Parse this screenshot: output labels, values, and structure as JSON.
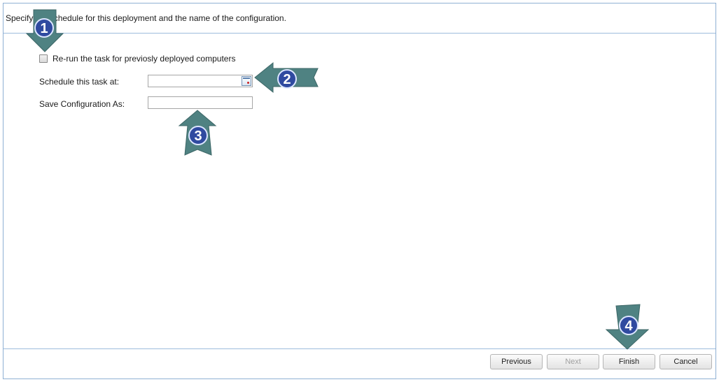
{
  "header": {
    "text": "Specify the schedule for this deployment and the name of the configuration."
  },
  "form": {
    "rerun_label": "Re-run the task for previosly deployed computers",
    "rerun_checked": false,
    "schedule_label": "Schedule this task at:",
    "schedule_value": "",
    "save_label": "Save Configuration As:",
    "save_value": ""
  },
  "footer": {
    "previous": "Previous",
    "next": "Next",
    "finish": "Finish",
    "cancel": "Cancel"
  },
  "callouts": [
    {
      "number": "1",
      "direction": "down"
    },
    {
      "number": "2",
      "direction": "left"
    },
    {
      "number": "3",
      "direction": "up"
    },
    {
      "number": "4",
      "direction": "down"
    }
  ],
  "colors": {
    "arrow_fill": "#4f8282",
    "badge_fill": "#2f4aa0",
    "border": "#8fb0d4"
  }
}
